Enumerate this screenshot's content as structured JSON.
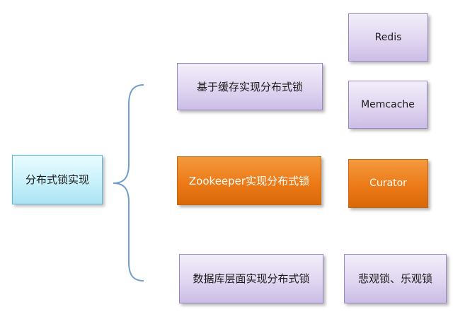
{
  "diagram": {
    "root": {
      "label": "分布式锁实现"
    },
    "branches": [
      {
        "label": "基于缓存实现分布式锁",
        "children": [
          {
            "label": "Redis"
          },
          {
            "label": "Memcache"
          }
        ]
      },
      {
        "label": "Zookeeper实现分布式锁",
        "highlighted": true,
        "children": [
          {
            "label": "Curator"
          }
        ]
      },
      {
        "label": "数据库层面实现分布式锁",
        "children": [
          {
            "label": "悲观锁、乐观锁"
          }
        ]
      }
    ]
  },
  "colors": {
    "bracket": "#6f9ecb",
    "box_purple": "#e0d6f1",
    "box_orange": "#ec7a17",
    "box_cyan": "#c9f1fb"
  }
}
